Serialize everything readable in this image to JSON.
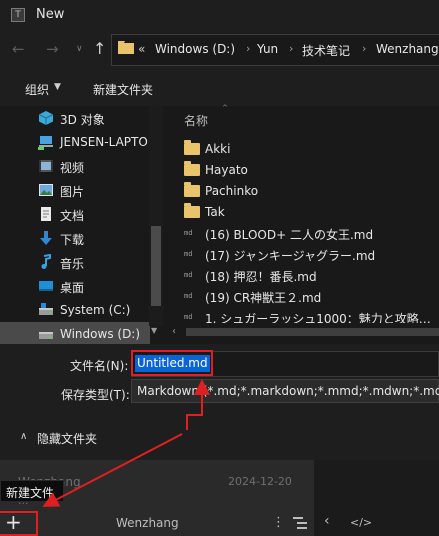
{
  "dialog": {
    "title": "New",
    "title_icon": "T",
    "address": {
      "overflow": "«",
      "crumbs": [
        "Windows (D:)",
        "Yun",
        "技术笔记",
        "Wenzhang"
      ]
    },
    "toolbar": {
      "organize": "组织",
      "new_folder": "新建文件夹"
    },
    "nav_items": [
      {
        "label": "3D 对象",
        "icon": "3d-objects-icon"
      },
      {
        "label": "JENSEN-LAPTO",
        "icon": "network-computer-icon"
      },
      {
        "label": "视频",
        "icon": "videos-icon"
      },
      {
        "label": "图片",
        "icon": "pictures-icon"
      },
      {
        "label": "文档",
        "icon": "documents-icon"
      },
      {
        "label": "下载",
        "icon": "downloads-icon"
      },
      {
        "label": "音乐",
        "icon": "music-icon"
      },
      {
        "label": "桌面",
        "icon": "desktop-icon"
      },
      {
        "label": "System (C:)",
        "icon": "drive-icon"
      },
      {
        "label": "Windows (D:)",
        "icon": "drive-icon"
      }
    ],
    "file_list": {
      "column_name": "名称",
      "items": [
        {
          "name": "Akki",
          "type": "folder"
        },
        {
          "name": "Hayato",
          "type": "folder"
        },
        {
          "name": "Pachinko",
          "type": "folder"
        },
        {
          "name": "Tak",
          "type": "folder"
        },
        {
          "name": "(16) BLOOD+ 二人の女王.md",
          "type": "md"
        },
        {
          "name": "(17) ジャンキージャグラー.md",
          "type": "md"
        },
        {
          "name": "(18) 押忍！番長.md",
          "type": "md"
        },
        {
          "name": "(19) CR神獣王２.md",
          "type": "md"
        },
        {
          "name": "1. シュガーラッシュ1000：魅力と攻略…",
          "type": "md"
        }
      ]
    },
    "filename_label": "文件名(N):",
    "filename_value": "Untitled.md",
    "filetype_label": "保存类型(T):",
    "filetype_value": "Markdown (*.md;*.markdown;*.mmd;*.mdwn;*.mdow",
    "hide_folders": "隐藏文件夹"
  },
  "app": {
    "doc_title": "Wenzhang",
    "doc_date": "2024-12-20",
    "doc_sub": "...",
    "tooltip": "新建文件",
    "new_button_glyph": "+",
    "folder_label": "Wenzhang"
  },
  "colors": {
    "annotation": "#e02020",
    "selection": "#0a64d6",
    "folder": "#e9c46a"
  }
}
